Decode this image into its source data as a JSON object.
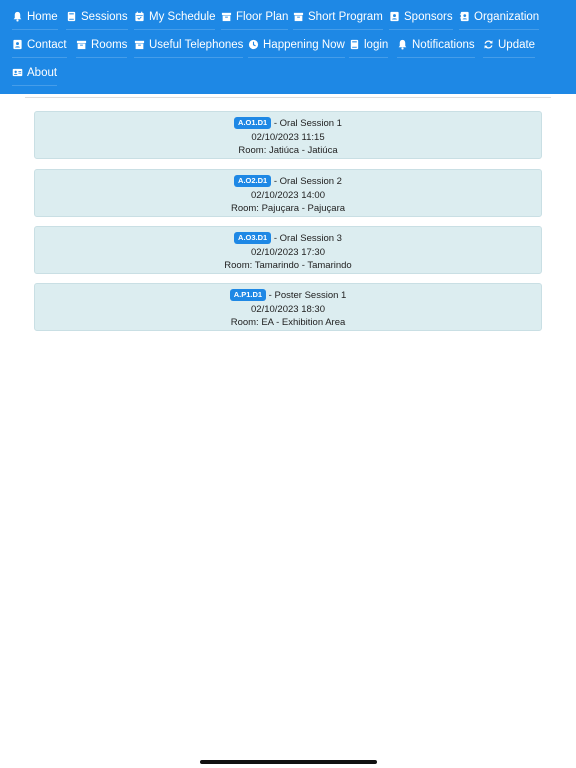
{
  "nav": {
    "home": "Home",
    "sessions": "Sessions",
    "my_schedule": "My Schedule",
    "floor_plan": "Floor Plan",
    "short_program": "Short Program",
    "sponsors": "Sponsors",
    "organization": "Organization",
    "contact": "Contact",
    "rooms": "Rooms",
    "useful_telephones": "Useful Telephones",
    "happening_now": "Happening Now",
    "login": "login",
    "notifications": "Notifications",
    "update": "Update",
    "about": "About"
  },
  "colors": {
    "header": "#1e88e5",
    "card_bg": "#dcedf0",
    "badge": "#1e88e5"
  },
  "sessions": [
    {
      "code": "A.O1.D1",
      "title": " - Oral Session 1",
      "datetime": "02/10/2023 11:15",
      "room": "Room: Jatiúca - Jatiúca"
    },
    {
      "code": "A.O2.D1",
      "title": " - Oral Session 2",
      "datetime": "02/10/2023 14:00",
      "room": "Room: Pajuçara - Pajuçara"
    },
    {
      "code": "A.O3.D1",
      "title": " - Oral Session 3",
      "datetime": "02/10/2023 17:30",
      "room": "Room: Tamarindo - Tamarindo"
    },
    {
      "code": "A.P1.D1",
      "title": " - Poster Session 1",
      "datetime": "02/10/2023 18:30",
      "room": "Room: EA - Exhibition Area"
    }
  ]
}
